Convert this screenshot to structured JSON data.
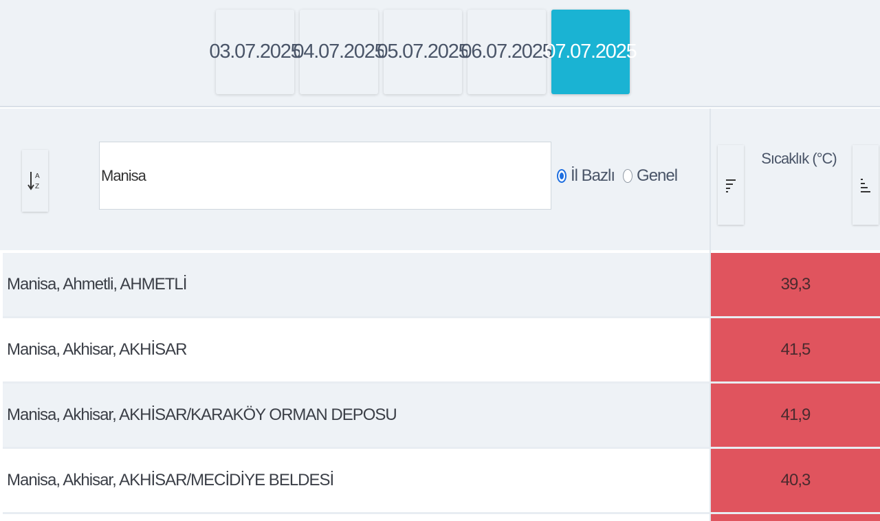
{
  "date_tabs": [
    {
      "label": "03.07.2025",
      "active": false
    },
    {
      "label": "04.07.2025",
      "active": false
    },
    {
      "label": "05.07.2025",
      "active": false
    },
    {
      "label": "06.07.2025",
      "active": false
    },
    {
      "label": "07.07.2025",
      "active": true
    }
  ],
  "filter": {
    "sort_icon": "sort-alpha-az-icon",
    "search_value": "Manisa",
    "radio_options": [
      {
        "label": "İl Bazlı",
        "checked": true
      },
      {
        "label": "Genel",
        "checked": false
      }
    ]
  },
  "value_column": {
    "title": "Sıcaklık (°C)",
    "sort_desc_icon": "sort-descending-icon",
    "sort_asc_icon": "sort-ascending-icon",
    "cell_color": "#e0545e"
  },
  "rows": [
    {
      "location": "Manisa, Ahmetli, AHMETLİ",
      "value": "39,3"
    },
    {
      "location": "Manisa, Akhisar, AKHİSAR",
      "value": "41,5"
    },
    {
      "location": "Manisa, Akhisar, AKHİSAR/KARAKÖY ORMAN DEPOSU",
      "value": "41,9"
    },
    {
      "location": "Manisa, Akhisar, AKHİSAR/MECİDİYE BELDESİ",
      "value": "40,3"
    }
  ],
  "colors": {
    "active_tab": "#1ab3d3",
    "panel_bg": "#eef2f6",
    "radio_accent": "#1f6fe0"
  }
}
